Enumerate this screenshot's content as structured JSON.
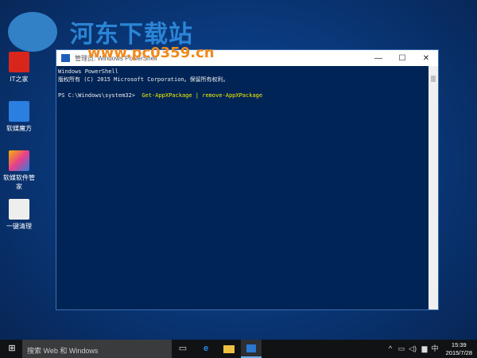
{
  "watermark": {
    "name": "河东下载站",
    "url": "www.pc0359.cn"
  },
  "desktop_icons": [
    {
      "label": "IT之家"
    },
    {
      "label": "软媒魔方"
    },
    {
      "label": "软媒软件管家"
    },
    {
      "label": "一键清理"
    }
  ],
  "window": {
    "title": "管理员: Windows PowerShell",
    "lines": [
      "Windows PowerShell",
      "版权所有 (C) 2015 Microsoft Corporation。保留所有权利。"
    ],
    "prompt": "PS C:\\Windows\\system32>",
    "command": "Get-AppXPackage | remove-AppXPackage"
  },
  "taskbar": {
    "search_placeholder": "搜索 Web 和 Windows",
    "ime": "中",
    "time": "15:39",
    "date": "2015/7/28"
  }
}
